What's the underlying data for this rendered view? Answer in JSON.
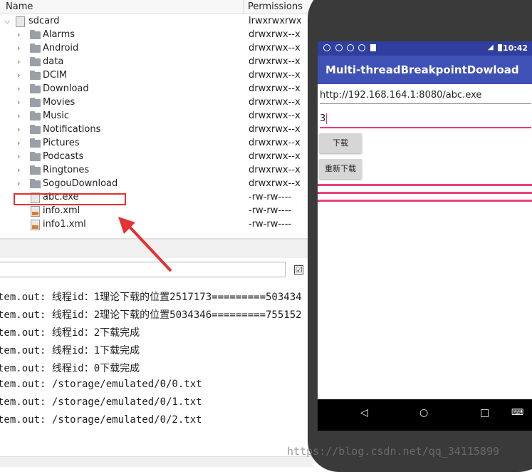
{
  "explorer": {
    "columns": {
      "name": "Name",
      "permissions": "Permissions"
    },
    "root": {
      "name": "sdcard",
      "permissions": "lrwxrwxrwx"
    },
    "folders": [
      {
        "name": "Alarms",
        "permissions": "drwxrwx--x"
      },
      {
        "name": "Android",
        "permissions": "drwxrwx--x"
      },
      {
        "name": "data",
        "permissions": "drwxrwx--x"
      },
      {
        "name": "DCIM",
        "permissions": "drwxrwx--x"
      },
      {
        "name": "Download",
        "permissions": "drwxrwx--x"
      },
      {
        "name": "Movies",
        "permissions": "drwxrwx--x"
      },
      {
        "name": "Music",
        "permissions": "drwxrwx--x"
      },
      {
        "name": "Notifications",
        "permissions": "drwxrwx--x"
      },
      {
        "name": "Pictures",
        "permissions": "drwxrwx--x"
      },
      {
        "name": "Podcasts",
        "permissions": "drwxrwx--x"
      },
      {
        "name": "Ringtones",
        "permissions": "drwxrwx--x"
      },
      {
        "name": "SogouDownload",
        "permissions": "drwxrwx--x"
      }
    ],
    "files": [
      {
        "name": "abc.exe",
        "permissions": "-rw-rw----"
      },
      {
        "name": "info.xml",
        "permissions": "-rw-rw----"
      },
      {
        "name": "info1.xml",
        "permissions": "-rw-rw----"
      }
    ]
  },
  "console": {
    "filter_checkbox": "☑",
    "lines": [
      "tem.out: 线程id：1理论下载的位置2517173=========503434",
      "tem.out: 线程id：2理论下载的位置5034346=========755152",
      "tem.out: 线程id：2下载完成",
      "tem.out: 线程id：1下载完成",
      "tem.out: 线程id：0下载完成",
      "tem.out: /storage/emulated/0/0.txt",
      "tem.out: /storage/emulated/0/1.txt",
      "tem.out: /storage/emulated/0/2.txt"
    ]
  },
  "phone": {
    "status_time": "10:42",
    "app_title": "Multi-threadBreakpointDowload",
    "url_value": "http://192.168.164.1:8080/abc.exe",
    "threads_value": "3",
    "download_button": "下载",
    "redownload_button": "重新下载",
    "progress_values": [
      1,
      1,
      1
    ]
  },
  "watermark": "https://blog.csdn.net/qq_34115899",
  "colors": {
    "accent": "#3f51b5",
    "status": "#303f9f",
    "progress": "#e8417b",
    "highlight": "#e23232"
  }
}
